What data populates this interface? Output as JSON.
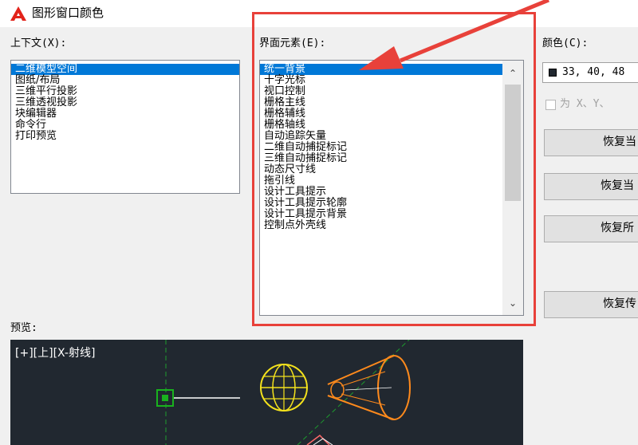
{
  "window": {
    "title": "图形窗口颜色",
    "accent": "#e8413a"
  },
  "context": {
    "label": "上下文(X):",
    "items": [
      "二维模型空间",
      "图纸/布局",
      "三维平行投影",
      "三维透视投影",
      "块编辑器",
      "命令行",
      "打印预览"
    ],
    "selected_index": 0
  },
  "interface": {
    "label": "界面元素(E):",
    "items": [
      "统一背景",
      "十字光标",
      "视口控制",
      "栅格主线",
      "栅格辅线",
      "栅格轴线",
      "自动追踪矢量",
      "二维自动捕捉标记",
      "三维自动捕捉标记",
      "动态尺寸线",
      "拖引线",
      "设计工具提示",
      "设计工具提示轮廓",
      "设计工具提示背景",
      "控制点外壳线"
    ],
    "selected_index": 0
  },
  "color": {
    "label": "颜色(C):",
    "value": "33, 40, 48",
    "swatch": "#212830",
    "checkbox_label": "为 X、Y、"
  },
  "buttons": {
    "restore_1": "恢复当",
    "restore_2": "恢复当",
    "restore_3": "恢复所",
    "restore_4": "恢复传"
  },
  "preview": {
    "label": "预览:",
    "viewport_label": "[+][上][X-射线]",
    "background": "#212830"
  }
}
